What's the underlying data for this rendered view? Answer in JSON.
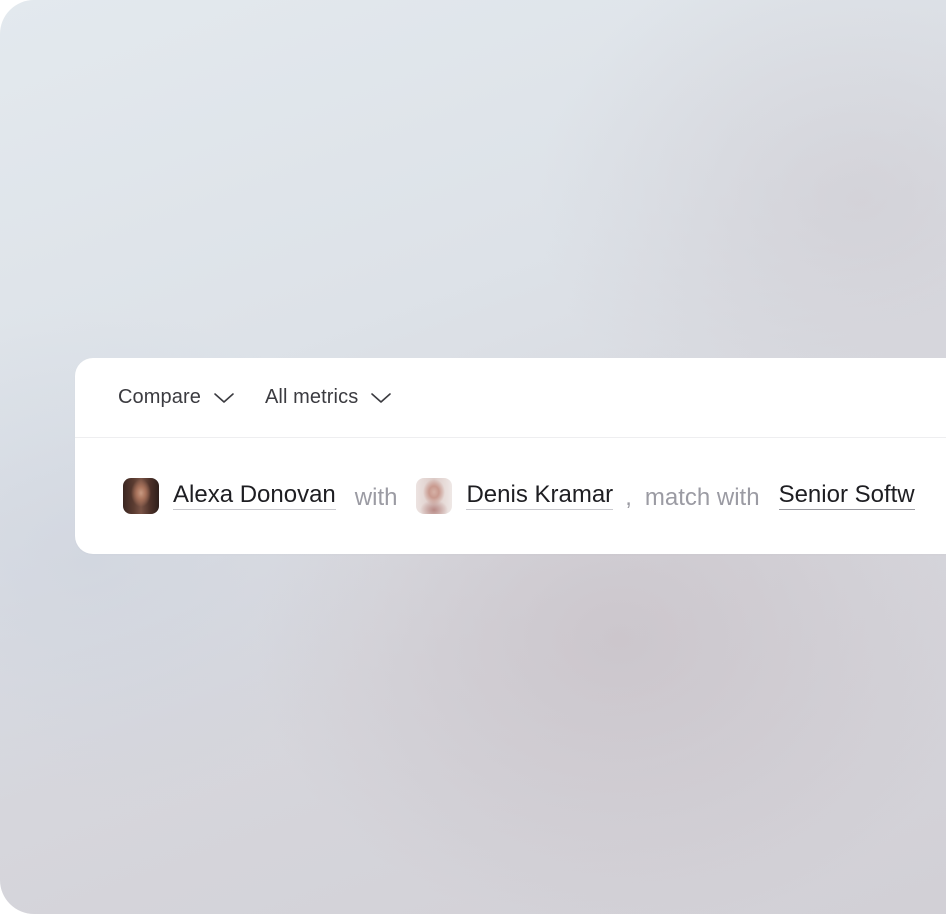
{
  "toolbar": {
    "compare_label": "Compare",
    "compare_icon": "chevron-down-icon",
    "metrics_label": "All metrics",
    "metrics_icon": "chevron-down-icon"
  },
  "comparison": {
    "person_a": {
      "name": "Alexa Donovan",
      "avatar": "avatar-photo"
    },
    "with_text": "with",
    "person_b": {
      "name": "Denis Kramar",
      "avatar": "avatar-photo"
    },
    "comma": ",",
    "match_text": "match with",
    "role": "Senior Softw"
  },
  "colors": {
    "text_primary": "#1e1e22",
    "text_muted": "#9b9ba3",
    "panel_bg": "#ffffff"
  }
}
